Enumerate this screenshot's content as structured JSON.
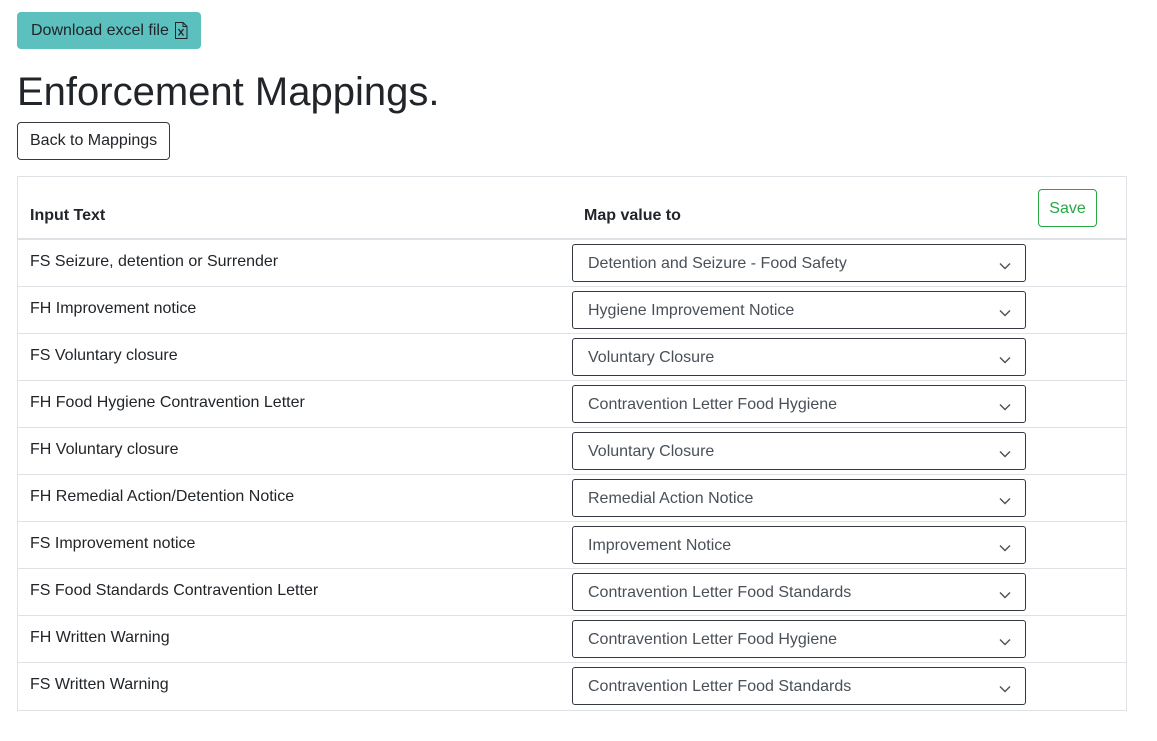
{
  "toolbar": {
    "download_label": "Download excel file",
    "download_icon": "excel-file-icon"
  },
  "page": {
    "title": "Enforcement Mappings."
  },
  "nav": {
    "back_label": "Back to Mappings"
  },
  "table": {
    "headers": {
      "input_text": "Input Text",
      "map_value_to": "Map value to"
    },
    "save_label": "Save",
    "rows": [
      {
        "input": "FS Seizure, detention or Surrender",
        "mapped": "Detention and Seizure - Food Safety"
      },
      {
        "input": "FH Improvement notice",
        "mapped": "Hygiene Improvement Notice"
      },
      {
        "input": "FS Voluntary closure",
        "mapped": "Voluntary Closure"
      },
      {
        "input": "FH Food Hygiene Contravention Letter",
        "mapped": "Contravention Letter Food Hygiene"
      },
      {
        "input": "FH Voluntary closure",
        "mapped": "Voluntary Closure"
      },
      {
        "input": "FH Remedial Action/Detention Notice",
        "mapped": "Remedial Action Notice"
      },
      {
        "input": "FS Improvement notice",
        "mapped": "Improvement Notice"
      },
      {
        "input": "FS Food Standards Contravention Letter",
        "mapped": "Contravention Letter Food Standards"
      },
      {
        "input": "FH Written Warning",
        "mapped": "Contravention Letter Food Hygiene"
      },
      {
        "input": "FS Written Warning",
        "mapped": "Contravention Letter Food Standards"
      }
    ]
  },
  "colors": {
    "download_button_bg": "#5bc0be",
    "save_button": "#28a745",
    "border": "#dee2e6"
  }
}
